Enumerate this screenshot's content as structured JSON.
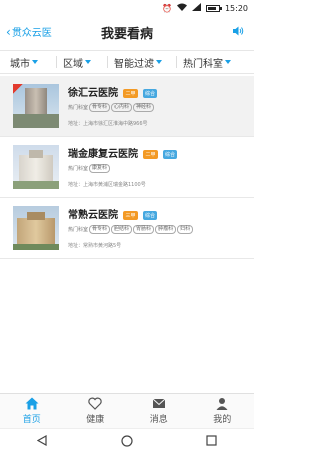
{
  "status_bar": {
    "time": "15:20",
    "battery_level": 0.7
  },
  "header": {
    "back_label": "贯众云医",
    "title": "我要看病"
  },
  "filters": [
    "城市",
    "区域",
    "智能过滤",
    "热门科室"
  ],
  "hospitals": [
    {
      "name": "徐汇云医院",
      "badges": [
        "二甲",
        "综合"
      ],
      "tags_label": "热门科室",
      "tags": [
        "骨专科",
        "心内科",
        "神经科"
      ],
      "address": "地址：上海市徐汇区淮海中路966号",
      "highlight": true
    },
    {
      "name": "瑞金康复云医院",
      "badges": [
        "二甲",
        "综合"
      ],
      "tags_label": "热门科室",
      "tags": [
        "康复科"
      ],
      "address": "地址：上海市黄浦区瑞金路1100号",
      "highlight": false
    },
    {
      "name": "常熟云医院",
      "badges": [
        "三甲",
        "综合"
      ],
      "tags_label": "热门科室",
      "tags": [
        "骨专科",
        "胆结科",
        "胃肠科",
        "肿瘤科",
        "妇科"
      ],
      "address": "地址：常熟市黄河路5号",
      "highlight": false
    }
  ],
  "tabs": [
    {
      "label": "首页",
      "icon": "home-icon",
      "active": true
    },
    {
      "label": "健康",
      "icon": "heart-icon",
      "active": false
    },
    {
      "label": "消息",
      "icon": "mail-icon",
      "active": false
    },
    {
      "label": "我的",
      "icon": "user-icon",
      "active": false
    }
  ],
  "colors": {
    "accent": "#1aa0e6",
    "grade_badge": "#f39a25",
    "type_badge": "#46a8e0"
  }
}
